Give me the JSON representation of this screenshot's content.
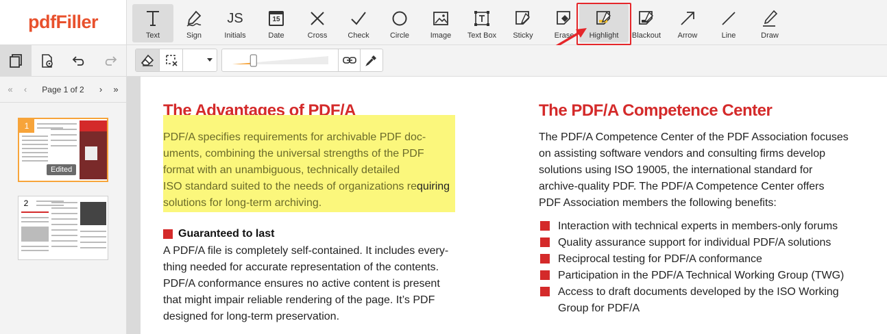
{
  "brand": {
    "name": "pdfFiller"
  },
  "colors": {
    "brand": "#e8512d",
    "heading": "#d42a2a",
    "highlight": "#fbf77c",
    "annotation": "#e5262a",
    "thumb_selected": "#f7a43a"
  },
  "toolbar": {
    "tools": [
      {
        "label": "Text",
        "icon": "text-icon",
        "active": true
      },
      {
        "label": "Sign",
        "icon": "sign-icon"
      },
      {
        "label": "Initials",
        "icon": "initials-icon",
        "glyph": "JS"
      },
      {
        "label": "Date",
        "icon": "calendar-icon",
        "glyph": "15"
      },
      {
        "label": "Cross",
        "icon": "cross-icon"
      },
      {
        "label": "Check",
        "icon": "check-icon"
      },
      {
        "label": "Circle",
        "icon": "circle-icon"
      },
      {
        "label": "Image",
        "icon": "image-icon"
      },
      {
        "label": "Text Box",
        "icon": "textbox-icon"
      },
      {
        "label": "Sticky",
        "icon": "sticky-icon"
      },
      {
        "label": "Erase",
        "icon": "erase-icon"
      },
      {
        "label": "Highlight",
        "icon": "highlight-icon",
        "selected": true
      },
      {
        "label": "Blackout",
        "icon": "blackout-icon"
      },
      {
        "label": "Arrow",
        "icon": "arrow-icon"
      },
      {
        "label": "Line",
        "icon": "line-icon"
      },
      {
        "label": "Draw",
        "icon": "draw-icon"
      }
    ]
  },
  "subtoolbar": {
    "left_buttons": [
      "pages-icon",
      "page-settings-icon",
      "undo-icon",
      "redo-icon"
    ],
    "right_buttons": [
      "eraser-icon",
      "clear-selection-icon",
      "color-dropdown",
      "opacity-slider",
      "link-icon",
      "eyedropper-icon"
    ],
    "opacity_level": 0.22
  },
  "sidebar": {
    "page_label": "Page 1 of 2",
    "thumbnails": [
      {
        "number": "1",
        "badge": "Edited",
        "selected": true
      },
      {
        "number": "2"
      }
    ]
  },
  "document": {
    "left": {
      "title": "The Advantages of PDF/A",
      "highlight_lines": [
        "PDF/A specifies requirements for archivable PDF doc-",
        "uments, combining the universal strengths of the PDF",
        "format with an unambiguous, technically detailed",
        "ISO standard suited to the needs of organizations re",
        "solutions for long-term archiving."
      ],
      "line4_tail": "quiring",
      "subheading": "Guaranteed to last",
      "body_lines": [
        "A PDF/A file is completely self-contained. It includes every-",
        "thing needed for accurate representation of the contents.",
        "PDF/A conformance ensures no active content is present",
        "that might impair reliable rendering of the page. It’s PDF",
        "designed for long-term preservation."
      ]
    },
    "right": {
      "title": "The PDF/A Competence Center",
      "body_lines": [
        "The PDF/A Competence Center of the PDF Association focuses",
        "on assisting software vendors and consulting firms develop",
        "solutions using ISO 19005, the international standard for",
        "archive-quality PDF. The PDF/A Competence Center offers",
        "PDF Association members the following benefits:"
      ],
      "bullets": [
        "Interaction with technical experts in members-only forums",
        "Quality assurance support for individual PDF/A solutions",
        "Reciprocal testing for PDF/A conformance",
        "Participation in the PDF/A Technical Working Group (TWG)",
        "Access to draft documents developed by the ISO Working"
      ],
      "bullet_continuation": "Group for PDF/A"
    }
  }
}
